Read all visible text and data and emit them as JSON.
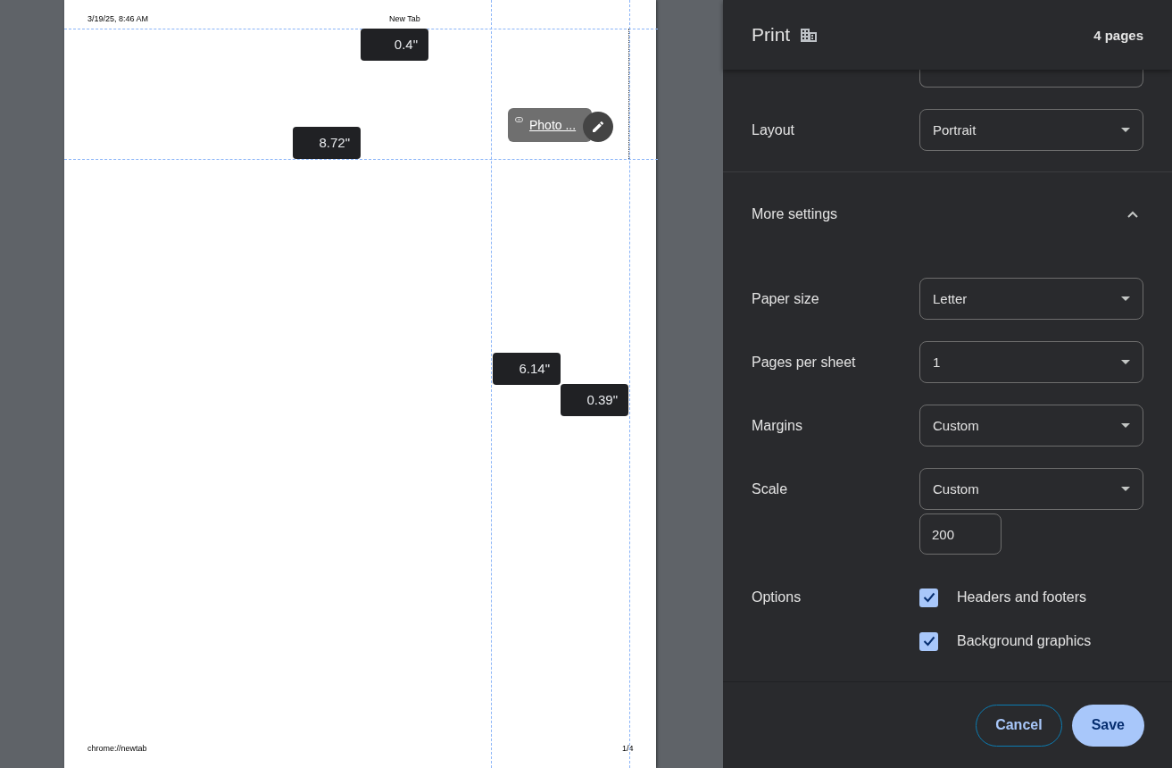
{
  "preview": {
    "header_left": "3/19/25, 8:46 AM",
    "header_center": "New Tab",
    "footer_left": "chrome://newtab",
    "footer_right": "1/4",
    "margin_tooltips": [
      {
        "text": "0.4\""
      },
      {
        "text": "8.72\""
      },
      {
        "text": "6.14\""
      },
      {
        "text": "0.39\""
      }
    ],
    "link_chip": {
      "text": "Photo ..."
    }
  },
  "panel": {
    "title": "Print",
    "page_count": "4 pages",
    "settings": [
      {
        "kind": "select",
        "label": "Layout",
        "value": "Portrait"
      },
      {
        "kind": "section",
        "label": "More settings",
        "expanded": true
      },
      {
        "kind": "select",
        "label": "Paper size",
        "value": "Letter"
      },
      {
        "kind": "select",
        "label": "Pages per sheet",
        "value": "1"
      },
      {
        "kind": "select",
        "label": "Margins",
        "value": "Custom"
      },
      {
        "kind": "select",
        "label": "Scale",
        "value": "Custom",
        "input": "200"
      },
      {
        "kind": "checkboxes",
        "label": "Options",
        "options": [
          {
            "label": "Headers and footers",
            "checked": true
          },
          {
            "label": "Background graphics",
            "checked": true
          }
        ]
      }
    ],
    "buttons": [
      {
        "label": "Cancel",
        "kind": "secondary"
      },
      {
        "label": "Save",
        "kind": "primary"
      }
    ]
  }
}
